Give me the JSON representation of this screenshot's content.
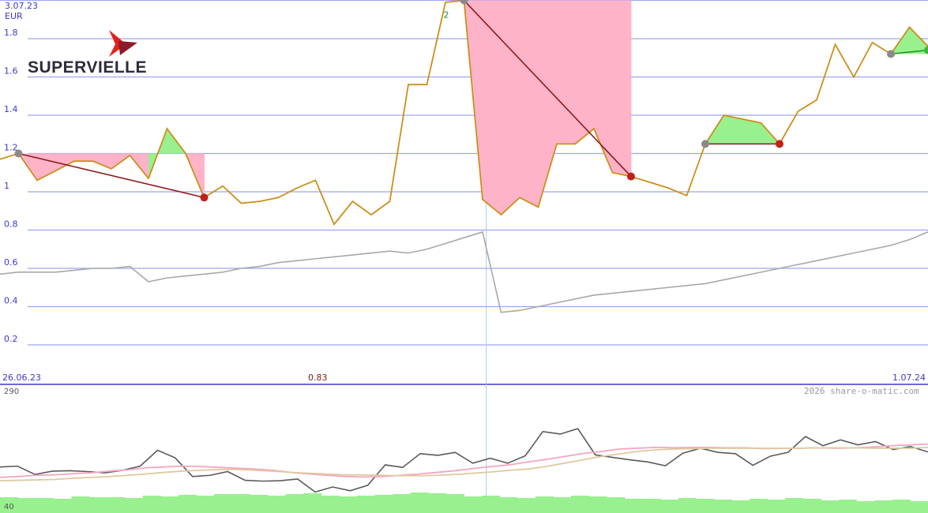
{
  "logo": {
    "text": "SUPERVIELLE",
    "colors": {
      "red": "#e2231a",
      "dark_red": "#8b1a2b"
    }
  },
  "header": {
    "date": "3.07.23",
    "currency": "EUR"
  },
  "footer_labels": {
    "start_date": "26.06.23",
    "mid_value": "0.83",
    "end_date": "1.07.24"
  },
  "copyright": "2026 share-o-matic.com",
  "colors": {
    "grid": "#9aa6ef",
    "price": "#cc8f1a",
    "ma_main": "#a8a8a8",
    "loss_fill": "#ffb3c8",
    "gain_fill": "#99f08f",
    "trade_line": "#8b1a1a",
    "vol_bar": "#99f08f",
    "osc_dark": "#5a5a5a",
    "osc_pink": "#f4a6c0",
    "osc_tan": "#e0c9a0"
  },
  "chart_data": [
    {
      "type": "line",
      "ylabel": "EUR",
      "ylim": [
        0.1,
        2.0
      ],
      "yticks": [
        "0.2",
        "0.4",
        "0.6",
        "0.8",
        "1",
        "1.2",
        "1.4",
        "1.6",
        "1.8"
      ],
      "grid": true,
      "x_range": [
        0,
        50
      ],
      "series": [
        {
          "role": "price",
          "x": [
            0,
            1,
            2,
            3,
            4,
            5,
            6,
            7,
            8,
            9,
            10,
            11,
            12,
            13,
            14,
            15,
            16,
            17,
            18,
            19,
            20,
            21,
            22,
            23,
            24,
            25,
            26,
            27,
            28,
            29,
            30,
            31,
            32,
            33,
            34,
            35,
            36,
            37,
            38,
            39,
            40,
            41,
            42,
            43,
            44,
            45,
            46,
            47,
            48,
            49,
            50
          ],
          "values": [
            1.17,
            1.2,
            1.06,
            1.11,
            1.16,
            1.16,
            1.12,
            1.19,
            1.07,
            1.33,
            1.2,
            0.97,
            1.03,
            0.94,
            0.95,
            0.97,
            1.02,
            1.06,
            0.83,
            0.95,
            0.88,
            0.95,
            1.56,
            1.56,
            1.99,
            2.0,
            0.96,
            0.88,
            0.97,
            0.92,
            1.25,
            1.25,
            1.33,
            1.1,
            1.08,
            1.05,
            1.02,
            0.98,
            1.25,
            1.4,
            1.38,
            1.36,
            1.25,
            1.42,
            1.48,
            1.77,
            1.6,
            1.78,
            1.72,
            1.86,
            1.76
          ]
        },
        {
          "role": "moving-average",
          "x": [
            0,
            1,
            2,
            3,
            4,
            5,
            6,
            7,
            8,
            9,
            10,
            11,
            12,
            13,
            14,
            15,
            16,
            17,
            18,
            19,
            20,
            21,
            22,
            23,
            24,
            25,
            26,
            27,
            28,
            29,
            30,
            31,
            32,
            33,
            34,
            35,
            36,
            37,
            38,
            39,
            40,
            41,
            42,
            43,
            44,
            45,
            46,
            47,
            48,
            49,
            50
          ],
          "values": [
            0.57,
            0.58,
            0.58,
            0.58,
            0.59,
            0.6,
            0.6,
            0.61,
            0.53,
            0.55,
            0.56,
            0.57,
            0.58,
            0.6,
            0.61,
            0.63,
            0.64,
            0.65,
            0.66,
            0.67,
            0.68,
            0.69,
            0.68,
            0.7,
            0.73,
            0.76,
            0.79,
            0.37,
            0.38,
            0.4,
            0.42,
            0.44,
            0.46,
            0.47,
            0.48,
            0.49,
            0.5,
            0.51,
            0.52,
            0.54,
            0.56,
            0.58,
            0.6,
            0.62,
            0.64,
            0.66,
            0.68,
            0.7,
            0.72,
            0.75,
            0.79
          ]
        }
      ],
      "trades": [
        {
          "entry_x": 1,
          "entry_y": 1.2,
          "exit_x": 11,
          "exit_y": 0.97,
          "result": "loss"
        },
        {
          "entry_x": 25,
          "entry_y": 2.0,
          "exit_x": 34,
          "exit_y": 1.08,
          "result": "loss",
          "label": "2"
        },
        {
          "entry_x": 38,
          "entry_y": 1.25,
          "exit_x": 42,
          "exit_y": 1.25,
          "result": "loss"
        },
        {
          "entry_x": 48,
          "entry_y": 1.72,
          "exit_x": 50,
          "exit_y": 1.74,
          "result": "gain"
        }
      ],
      "cursor_x": 26.2
    },
    {
      "type": "line",
      "ylim": [
        40,
        290
      ],
      "ytick_labels": [
        "290",
        "40"
      ],
      "x_range": [
        0,
        50
      ],
      "series": [
        {
          "role": "oscillator",
          "values": [
            105,
            107,
            87,
            95,
            96,
            94,
            91,
            97,
            107,
            145,
            127,
            82,
            85,
            94,
            73,
            71,
            72,
            76,
            45,
            57,
            48,
            61,
            110,
            104,
            137,
            133,
            140,
            114,
            126,
            114,
            132,
            190,
            184,
            197,
            134,
            128,
            122,
            117,
            108,
            138,
            150,
            140,
            137,
            109,
            131,
            140,
            178,
            156,
            170,
            158,
            166,
            147,
            154,
            141
          ]
        },
        {
          "role": "average-1",
          "values": [
            80,
            82,
            85,
            86,
            89,
            91,
            95,
            98,
            103,
            105,
            107,
            106,
            104,
            102,
            100,
            97,
            92,
            88,
            85,
            82,
            81,
            82,
            85,
            88,
            92,
            96,
            101,
            106,
            110,
            117,
            123,
            130,
            137,
            142,
            148,
            150,
            152,
            151,
            152,
            152,
            151,
            151,
            149,
            150,
            150,
            151,
            150,
            151,
            153,
            156,
            158,
            160
          ]
        },
        {
          "role": "average-2",
          "values": [
            72,
            73,
            74,
            75,
            78,
            80,
            82,
            85,
            88,
            92,
            95,
            97,
            99,
            99,
            97,
            95,
            92,
            90,
            88,
            86,
            86,
            85,
            84,
            84,
            85,
            87,
            90,
            93,
            97,
            100,
            106,
            114,
            122,
            130,
            136,
            142,
            146,
            148,
            149,
            150,
            150,
            150,
            150,
            150,
            150,
            151,
            151,
            151,
            150,
            150,
            150,
            152
          ]
        }
      ],
      "volume": [
        20,
        19,
        19,
        18,
        21,
        20,
        20,
        19,
        22,
        21,
        23,
        22,
        24,
        24,
        23,
        22,
        24,
        25,
        22,
        21,
        22,
        23,
        24,
        26,
        25,
        24,
        21,
        22,
        20,
        19,
        21,
        20,
        22,
        21,
        20,
        18,
        18,
        17,
        19,
        18,
        17,
        16,
        18,
        17,
        19,
        18,
        16,
        17,
        15,
        16,
        17,
        15
      ]
    }
  ]
}
